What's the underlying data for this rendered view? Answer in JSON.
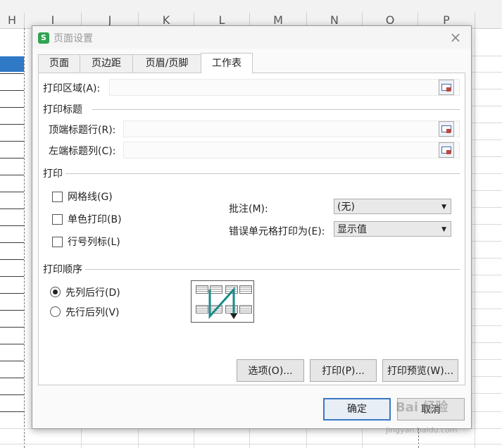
{
  "sheet": {
    "columns": [
      "H",
      "I",
      "J",
      "K",
      "L",
      "M",
      "N",
      "O",
      "P"
    ]
  },
  "dialog": {
    "title": "页面设置",
    "app_icon_letter": "S",
    "close_glyph": "×",
    "tabs": [
      "页面",
      "页边距",
      "页眉/页脚",
      "工作表"
    ],
    "active_tab": "工作表",
    "print_area_label": "打印区域(A):",
    "print_area_value": "",
    "print_titles_group": "打印标题",
    "top_rows_label": "顶端标题行(R):",
    "top_rows_value": "",
    "left_cols_label": "左端标题列(C):",
    "left_cols_value": "",
    "print_group": "打印",
    "gridlines_label": "网格线(G)",
    "gridlines_checked": false,
    "mono_label": "单色打印(B)",
    "mono_checked": false,
    "rowcol_label": "行号列标(L)",
    "rowcol_checked": false,
    "comments_label": "批注(M):",
    "comments_value": "(无)",
    "errors_label": "错误单元格打印为(E):",
    "errors_value": "显示值",
    "order_group": "打印顺序",
    "order_down_label": "先列后行(D)",
    "order_over_label": "先行后列(V)",
    "order_selected": "先列后行(D)",
    "options_button": "选项(O)...",
    "print_button": "打印(P)...",
    "preview_button": "打印预览(W)...",
    "ok_button": "确定",
    "cancel_button": "取消"
  },
  "watermark": {
    "text": "Bai 经验",
    "sub": "jingyan.baidu.com"
  },
  "colors": {
    "selected_cell": "#2f79c7",
    "primary_border": "#3a78c3",
    "order_arrow": "#1a8a8a"
  }
}
